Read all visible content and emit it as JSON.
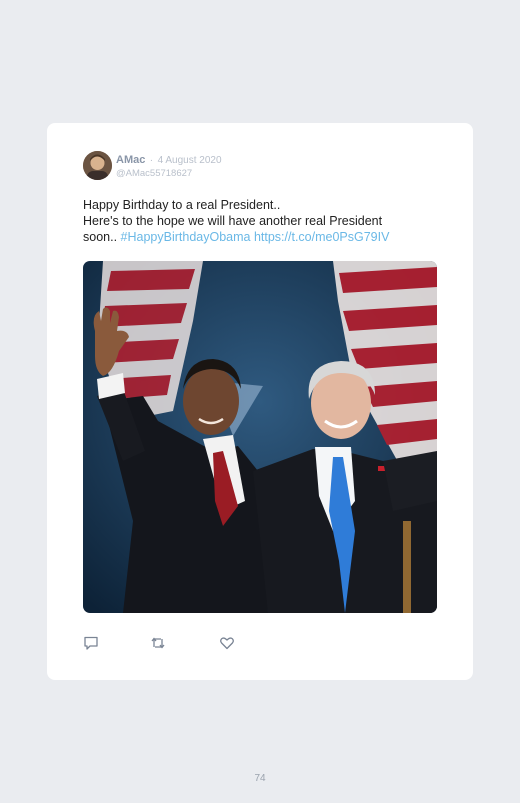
{
  "tweet": {
    "author_name": "AMac",
    "separator": "·",
    "date": "4 August 2020",
    "handle": "@AMac55718627",
    "text_line1": "Happy Birthday to a real President..",
    "text_line2": "Here's to the hope we will have another real President",
    "text_line3_prefix": "soon.. ",
    "hashtag": "#HappyBirthdayObama",
    "url": "https://t.co/me0PsG79IV",
    "image_alt": "Two men in dark suits waving on a stage with American flags behind them"
  },
  "actions": {
    "reply_icon": "reply-icon",
    "retweet_icon": "retweet-icon",
    "like_icon": "heart-icon"
  },
  "colors": {
    "background": "#eaecf0",
    "card": "#ffffff",
    "link": "#6ab8e6",
    "muted": "#b9c0cb"
  },
  "footer": {
    "page_number": "74"
  }
}
